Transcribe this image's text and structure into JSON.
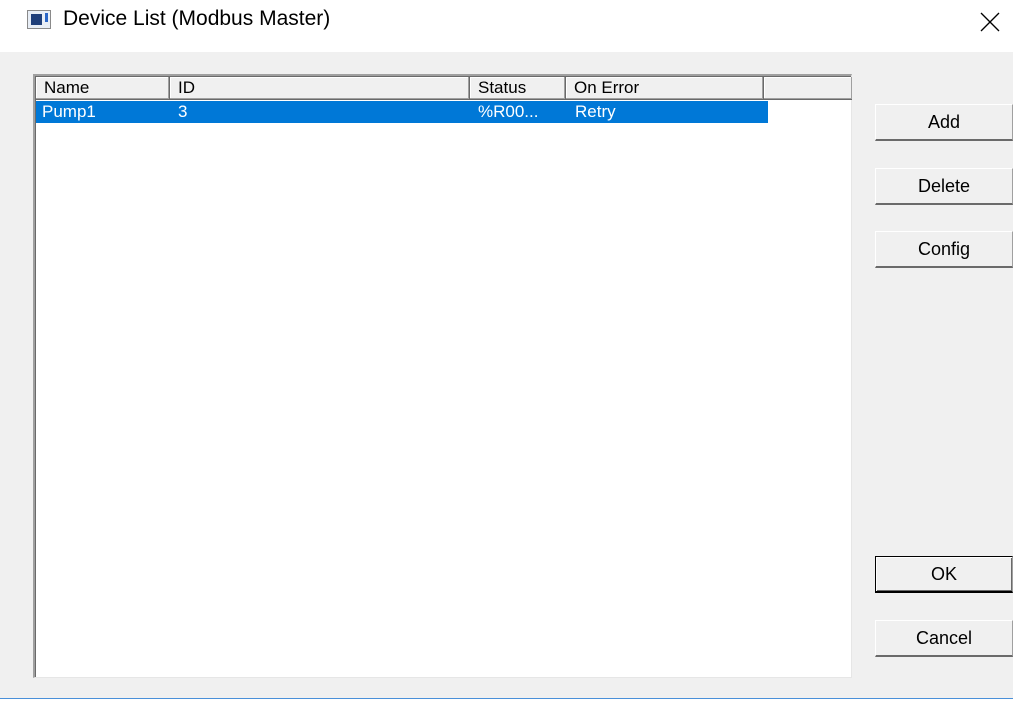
{
  "window": {
    "title": "Device List (Modbus Master)",
    "icon": "app-window-icon",
    "close_icon": "close-icon"
  },
  "listview": {
    "columns": [
      {
        "label": "Name"
      },
      {
        "label": "ID"
      },
      {
        "label": "Status"
      },
      {
        "label": "On Error"
      }
    ],
    "rows": [
      {
        "name": "Pump1",
        "id": "3",
        "status": "%R00...",
        "on_error": "Retry",
        "selected": true
      }
    ],
    "selection_color": "#0078d7"
  },
  "buttons": {
    "add": "Add",
    "delete": "Delete",
    "config": "Config",
    "ok": "OK",
    "cancel": "Cancel"
  }
}
